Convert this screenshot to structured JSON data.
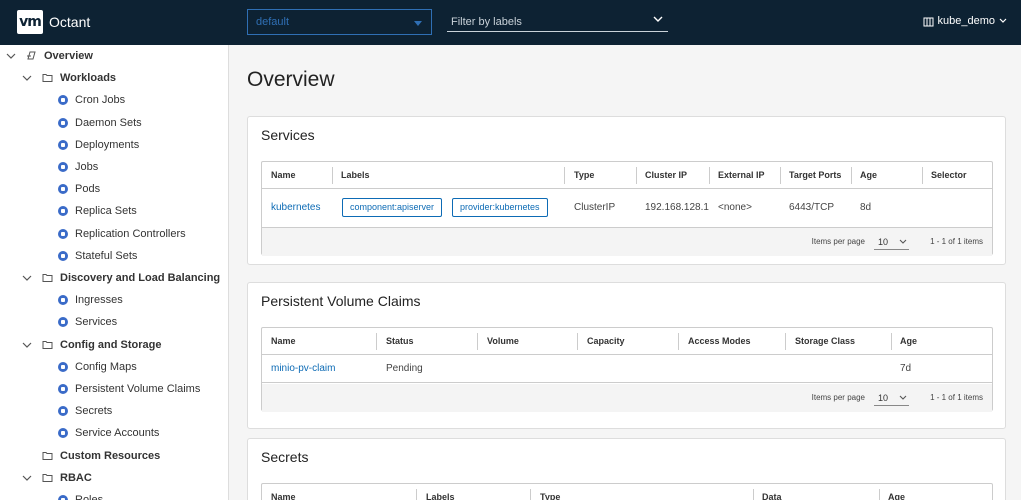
{
  "header": {
    "logo": "vm",
    "app_title": "Octant",
    "namespace": "default",
    "filter_placeholder": "Filter by labels",
    "context": "kube_demo"
  },
  "sidebar": {
    "items": [
      {
        "label": "Overview",
        "level": 0,
        "expanded": true,
        "kind": "root"
      },
      {
        "label": "Workloads",
        "level": 1,
        "expanded": true,
        "kind": "folder"
      },
      {
        "label": "Cron Jobs",
        "level": 2,
        "kind": "leaf"
      },
      {
        "label": "Daemon Sets",
        "level": 2,
        "kind": "leaf"
      },
      {
        "label": "Deployments",
        "level": 2,
        "kind": "leaf"
      },
      {
        "label": "Jobs",
        "level": 2,
        "kind": "leaf"
      },
      {
        "label": "Pods",
        "level": 2,
        "kind": "leaf"
      },
      {
        "label": "Replica Sets",
        "level": 2,
        "kind": "leaf"
      },
      {
        "label": "Replication Controllers",
        "level": 2,
        "kind": "leaf"
      },
      {
        "label": "Stateful Sets",
        "level": 2,
        "kind": "leaf"
      },
      {
        "label": "Discovery and Load Balancing",
        "level": 1,
        "expanded": true,
        "kind": "folder"
      },
      {
        "label": "Ingresses",
        "level": 2,
        "kind": "leaf"
      },
      {
        "label": "Services",
        "level": 2,
        "kind": "leaf"
      },
      {
        "label": "Config and Storage",
        "level": 1,
        "expanded": true,
        "kind": "folder"
      },
      {
        "label": "Config Maps",
        "level": 2,
        "kind": "leaf"
      },
      {
        "label": "Persistent Volume Claims",
        "level": 2,
        "kind": "leaf"
      },
      {
        "label": "Secrets",
        "level": 2,
        "kind": "leaf"
      },
      {
        "label": "Service Accounts",
        "level": 2,
        "kind": "leaf"
      },
      {
        "label": "Custom Resources",
        "level": 1,
        "kind": "folder-noexp"
      },
      {
        "label": "RBAC",
        "level": 1,
        "expanded": true,
        "kind": "folder"
      },
      {
        "label": "Roles",
        "level": 2,
        "kind": "leaf"
      }
    ]
  },
  "main": {
    "title": "Overview",
    "services": {
      "title": "Services",
      "columns": [
        "Name",
        "Labels",
        "Type",
        "Cluster IP",
        "External IP",
        "Target Ports",
        "Age",
        "Selector"
      ],
      "row": {
        "name": "kubernetes",
        "labels": [
          "component:apiserver",
          "provider:kubernetes"
        ],
        "type": "ClusterIP",
        "cluster_ip": "192.168.128.1",
        "external_ip": "<none>",
        "target_ports": "6443/TCP",
        "age": "8d",
        "selector": ""
      },
      "footer": {
        "items_per_page": "Items per page",
        "page_size": "10",
        "count": "1 - 1 of 1 items"
      }
    },
    "pvc": {
      "title": "Persistent Volume Claims",
      "columns": [
        "Name",
        "Status",
        "Volume",
        "Capacity",
        "Access Modes",
        "Storage Class",
        "Age"
      ],
      "row": {
        "name": "minio-pv-claim",
        "status": "Pending",
        "volume": "",
        "capacity": "",
        "access_modes": "",
        "storage_class": "",
        "age": "7d"
      },
      "footer": {
        "items_per_page": "Items per page",
        "page_size": "10",
        "count": "1 - 1 of 1 items"
      }
    },
    "secrets": {
      "title": "Secrets",
      "columns": [
        "Name",
        "Labels",
        "Type",
        "Data",
        "Age"
      ]
    }
  },
  "colors": {
    "header_bg": "#0d2233",
    "accent": "#0d6bb5",
    "namespace_border": "#2f6fb4",
    "nav_icon": "#3a6bc8"
  }
}
